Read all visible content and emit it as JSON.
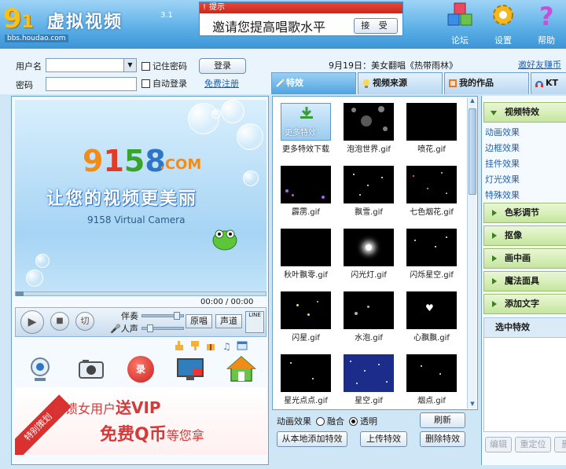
{
  "header": {
    "logo_num": "9158",
    "app_title": "虚拟视频",
    "version": "3.1",
    "watermark": "bbs.houdao.com",
    "notice": {
      "head": "提示",
      "text": "邀请您提高唱歌水平",
      "accept": "接 受"
    },
    "tools": [
      {
        "label": "论坛"
      },
      {
        "label": "设置"
      },
      {
        "label": "帮助"
      }
    ]
  },
  "login": {
    "username_label": "用户名",
    "password_label": "密码",
    "remember": "记住密码",
    "auto_login": "自动登录",
    "login_button": "登录",
    "register": "免费注册",
    "news": "9月19日：美女翻唱《热带雨林》",
    "friend_link": "邀好友赚币"
  },
  "tabs": [
    {
      "label": "特效"
    },
    {
      "label": "视频来源"
    },
    {
      "label": "我的作品"
    },
    {
      "label": "KT"
    }
  ],
  "preview": {
    "brand_digits": [
      "9",
      "1",
      "5",
      "8"
    ],
    "brand_com": ".COM",
    "slogan": "让您的视频更美丽",
    "sub": "9158 Virtual Camera",
    "time": "00:00 / 00:00"
  },
  "controls": {
    "cut": "切",
    "accompany": "伴奏",
    "voice": "人声",
    "original": "原唱",
    "channel": "声道",
    "line": "LINE"
  },
  "toolbar": {
    "record": "录"
  },
  "banner": {
    "line1_a": "反馈女用户",
    "line1_b": "送VIP",
    "line2_a": "免费Q币",
    "line2_b": "等您拿",
    "ribbon": "特别策划"
  },
  "effects": [
    {
      "label": "更多特效下载",
      "more": "更多特效"
    },
    {
      "label": "泡泡世界.gif"
    },
    {
      "label": "喷花.gif"
    },
    {
      "label": "霹雳.gif"
    },
    {
      "label": "飘雪.gif"
    },
    {
      "label": "七色烟花.gif"
    },
    {
      "label": "秋叶飘零.gif"
    },
    {
      "label": "闪光灯.gif"
    },
    {
      "label": "闪烁星空.gif"
    },
    {
      "label": "闪星.gif"
    },
    {
      "label": "水泡.gif"
    },
    {
      "label": "心飘飘.gif"
    },
    {
      "label": "星光点点.gif"
    },
    {
      "label": "星空.gif"
    },
    {
      "label": "烟点.gif"
    }
  ],
  "grid_controls": {
    "anim_label": "动画效果",
    "blend": "融合",
    "transparent": "透明",
    "refresh": "刷新",
    "add_local": "从本地添加特效",
    "upload": "上传特效",
    "delete": "删除特效"
  },
  "right_panel": {
    "categories": [
      {
        "label": "视频特效"
      },
      {
        "label": "色彩调节"
      },
      {
        "label": "抠像"
      },
      {
        "label": "画中画"
      },
      {
        "label": "魔法面具"
      },
      {
        "label": "添加文字"
      }
    ],
    "subitems": [
      "动画效果",
      "边框效果",
      "挂件效果",
      "灯光效果",
      "特殊效果"
    ],
    "selected_title": "选中特效",
    "edit": "编辑",
    "reset": "重定位",
    "del": "删"
  },
  "colors": {
    "accent": "#4fa3df",
    "brand_orange": "#f28c18",
    "banner_red": "#d43a3a",
    "category_green": "#c5e69c"
  }
}
